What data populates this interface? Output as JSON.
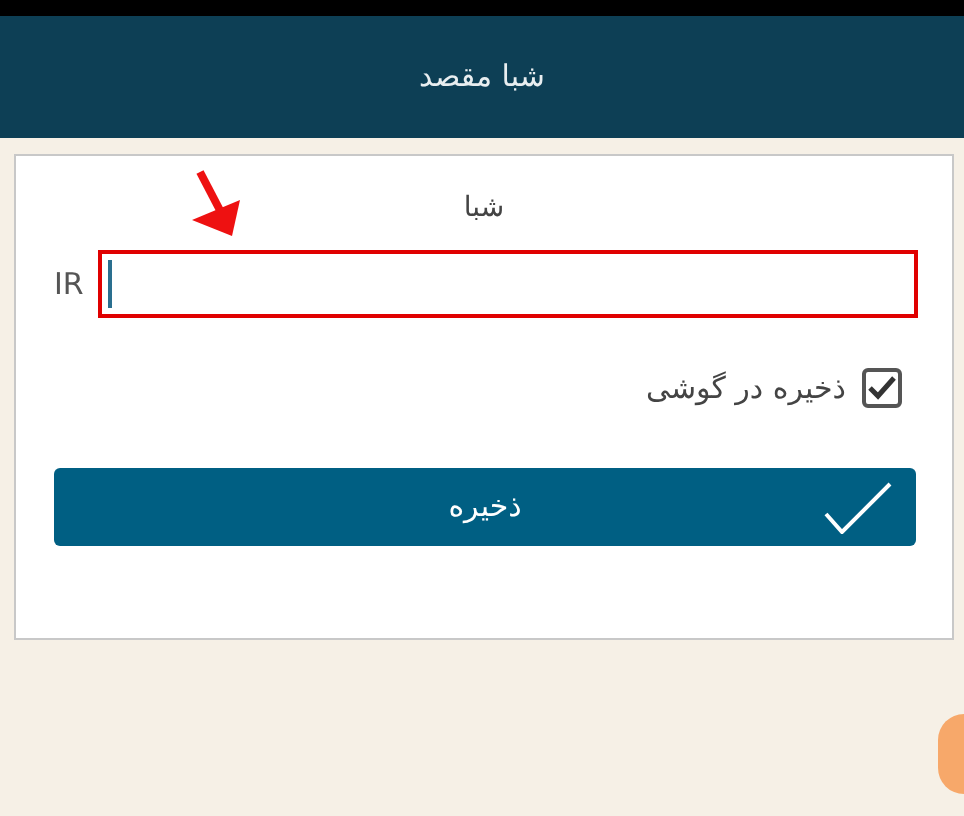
{
  "header": {
    "title": "شبا مقصد"
  },
  "form": {
    "field_label": "شبا",
    "prefix": "IR",
    "field": {
      "highlighted": true
    },
    "save_option": {
      "label": "ذخیره در گوشی",
      "checked": true
    },
    "submit_button": {
      "label": "ذخیره"
    }
  }
}
